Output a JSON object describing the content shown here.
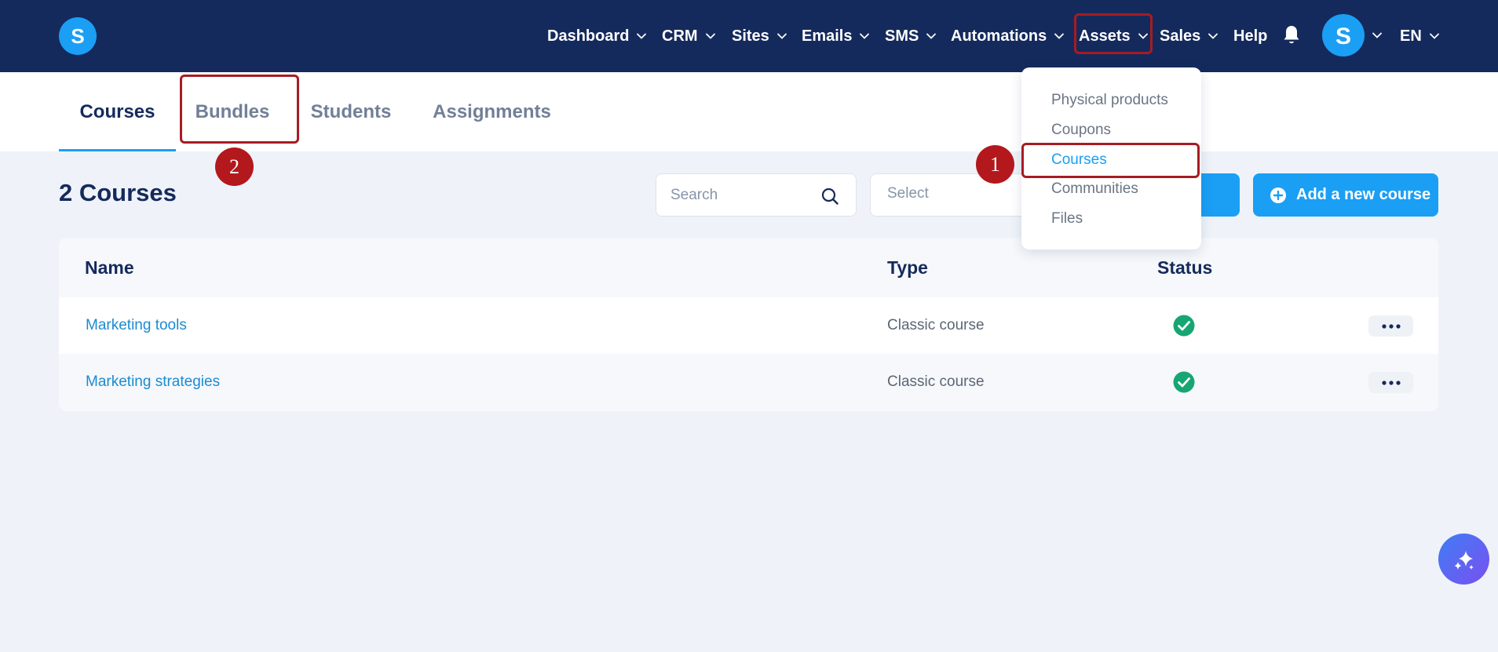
{
  "header": {
    "logo_letter": "S",
    "nav": [
      {
        "label": "Dashboard",
        "has_menu": true
      },
      {
        "label": "CRM",
        "has_menu": true
      },
      {
        "label": "Sites",
        "has_menu": true
      },
      {
        "label": "Emails",
        "has_menu": true
      },
      {
        "label": "SMS",
        "has_menu": true
      },
      {
        "label": "Automations",
        "has_menu": true
      },
      {
        "label": "Assets",
        "has_menu": true
      },
      {
        "label": "Sales",
        "has_menu": true
      },
      {
        "label": "Help",
        "has_menu": false
      }
    ],
    "language": "EN",
    "avatar_letter": "S"
  },
  "tabs": [
    {
      "label": "Courses",
      "active": true
    },
    {
      "label": "Bundles",
      "active": false
    },
    {
      "label": "Students",
      "active": false
    },
    {
      "label": "Assignments",
      "active": false
    }
  ],
  "toolbar": {
    "title": "2 Courses",
    "search_placeholder": "Search",
    "search_value": "",
    "select_placeholder": "Select",
    "add_label": "Add a new course"
  },
  "table": {
    "columns": [
      "Name",
      "Type",
      "Status"
    ],
    "rows": [
      {
        "name": "Marketing tools",
        "type": "Classic course",
        "status": "active"
      },
      {
        "name": "Marketing strategies",
        "type": "Classic course",
        "status": "active"
      }
    ]
  },
  "assets_menu": {
    "items": [
      {
        "label": "Physical products",
        "selected": false
      },
      {
        "label": "Coupons",
        "selected": false
      },
      {
        "label": "Courses",
        "selected": true
      },
      {
        "label": "Communities",
        "selected": false
      },
      {
        "label": "Files",
        "selected": false
      }
    ]
  },
  "annotations": {
    "steps": [
      "1",
      "2"
    ]
  },
  "icons": {
    "bell": "bell-icon",
    "search": "search-icon",
    "status": "check-circle-icon",
    "more": "more-horizontal-icon",
    "add": "plus-circle-icon",
    "fab": "sparkle-icon"
  },
  "colors": {
    "navbar": "#152a5c",
    "accent": "#1a9ff5",
    "status_green": "#17a673",
    "annotation_red": "#b3181d",
    "background": "#eff3f9"
  }
}
